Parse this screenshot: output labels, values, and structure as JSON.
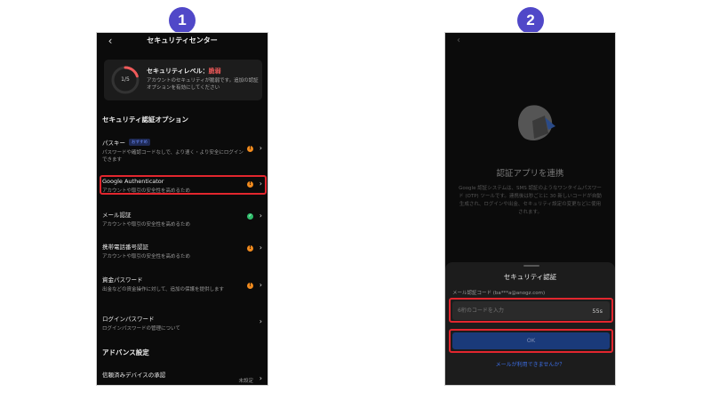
{
  "steps": [
    "1",
    "2"
  ],
  "colors": {
    "badge": "#5048c8",
    "highlight": "#e2262e",
    "danger": "#f05a5a",
    "warning": "#f08a1e",
    "success": "#2ebd6b",
    "link": "#3d6fe8"
  },
  "screen1": {
    "title": "セキュリティセンター",
    "security_card": {
      "progress_label": "1/5",
      "progress_fraction": 0.2,
      "level_label": "セキュリティレベル：",
      "level_value": "脆弱",
      "description": "アカウントのセキュリティが脆弱です。追加の認証オプションを有効にしてください"
    },
    "auth_section_title": "セキュリティ認証オプション",
    "items": [
      {
        "title": "パスキー",
        "badge": "おすすめ",
        "desc": "パスワードや確認コードなしで、より速く・より安全にログインできます",
        "status": "warning-icon"
      },
      {
        "title": "Google Authenticator",
        "desc": "アカウントや取引の安全性を高めるため",
        "status": "warning-icon"
      },
      {
        "title": "メール認証",
        "desc": "アカウントや取引の安全性を高めるため",
        "status": "check-icon"
      },
      {
        "title": "携帯電話番号認証",
        "desc": "アカウントや取引の安全性を高めるため",
        "status": "warning-icon"
      },
      {
        "title": "資金パスワード",
        "desc": "出金などの資金操作に対して、追加の保護を提供します",
        "status": "warning-icon"
      },
      {
        "title": "ログインパスワード",
        "desc": "ログインパスワードの管理について"
      }
    ],
    "advanced_title": "アドバンス設定",
    "advanced_item": {
      "title": "信頼済みデバイスの承認",
      "value": "未設定"
    }
  },
  "screen2": {
    "title": "認証アプリを連携",
    "description": "Google 認証システムは、SMS 認証のようなワンタイムパスワード (OTP) ツールです。連携後は秒ごとに 30 新しいコードが自動生成され、ログインや出金、セキュリティ設定の変更などに使用されます。",
    "sheet": {
      "title": "セキュリティ認証",
      "email_label": "メール認証コード (ba***a@anogz.com)",
      "code_placeholder": "6桁のコードを入力",
      "timer": "55s",
      "ok_label": "OK",
      "link": "メールが利用できませんか？"
    }
  }
}
